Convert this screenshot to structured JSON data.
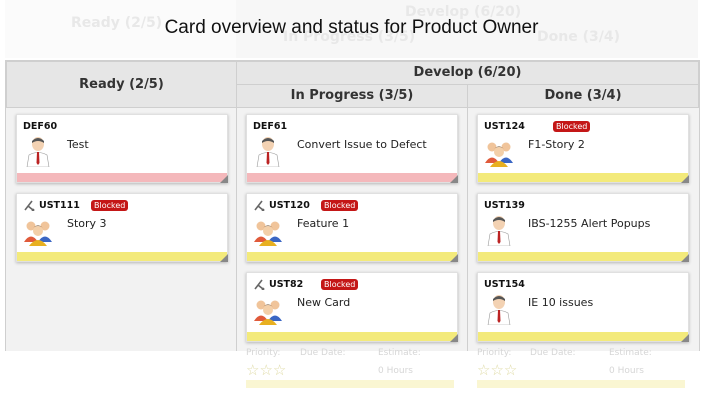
{
  "title": "Card overview and status for Product Owner",
  "ghost": {
    "ready": "Ready (2/5)",
    "develop": "Develop (6/20)",
    "in_progress": "In Progress (3/5)",
    "done": "Done (3/4)"
  },
  "headers": {
    "ready": "Ready (2/5)",
    "develop": "Develop (6/20)",
    "in_progress": "In Progress (3/5)",
    "done": "Done (3/4)"
  },
  "cards": {
    "def60": {
      "id": "DEF60",
      "title": "Test",
      "blocked": false,
      "strip": "pink"
    },
    "ust111": {
      "id": "UST111",
      "title": "Story 3",
      "blocked": true,
      "strip": "yellow"
    },
    "def61": {
      "id": "DEF61",
      "title": "Convert Issue to Defect",
      "blocked": false,
      "strip": "pink"
    },
    "ust120": {
      "id": "UST120",
      "title": "Feature 1",
      "blocked": true,
      "strip": "yellow"
    },
    "ust82": {
      "id": "UST82",
      "title": "New Card",
      "blocked": true,
      "strip": "yellow"
    },
    "ust124": {
      "id": "UST124",
      "title": "F1-Story 2",
      "blocked": true,
      "strip": "yellow"
    },
    "ust139": {
      "id": "UST139",
      "title": "IBS-1255 Alert Popups",
      "blocked": false,
      "strip": "yellow"
    },
    "ust154": {
      "id": "UST154",
      "title": "IE 10 issues",
      "blocked": false,
      "strip": "yellow"
    }
  },
  "badge_label": "Blocked",
  "footer_ghost": {
    "priority": "Priority:",
    "due_date": "Due Date:",
    "estimate": "Estimate:",
    "hours": "0 Hours",
    "stars": "☆☆☆"
  },
  "colors": {
    "blocked": "#c41717",
    "strip_pink": "#f4b8bb",
    "strip_yellow": "#f3ea7b",
    "header_bg": "#e6e6e6"
  }
}
